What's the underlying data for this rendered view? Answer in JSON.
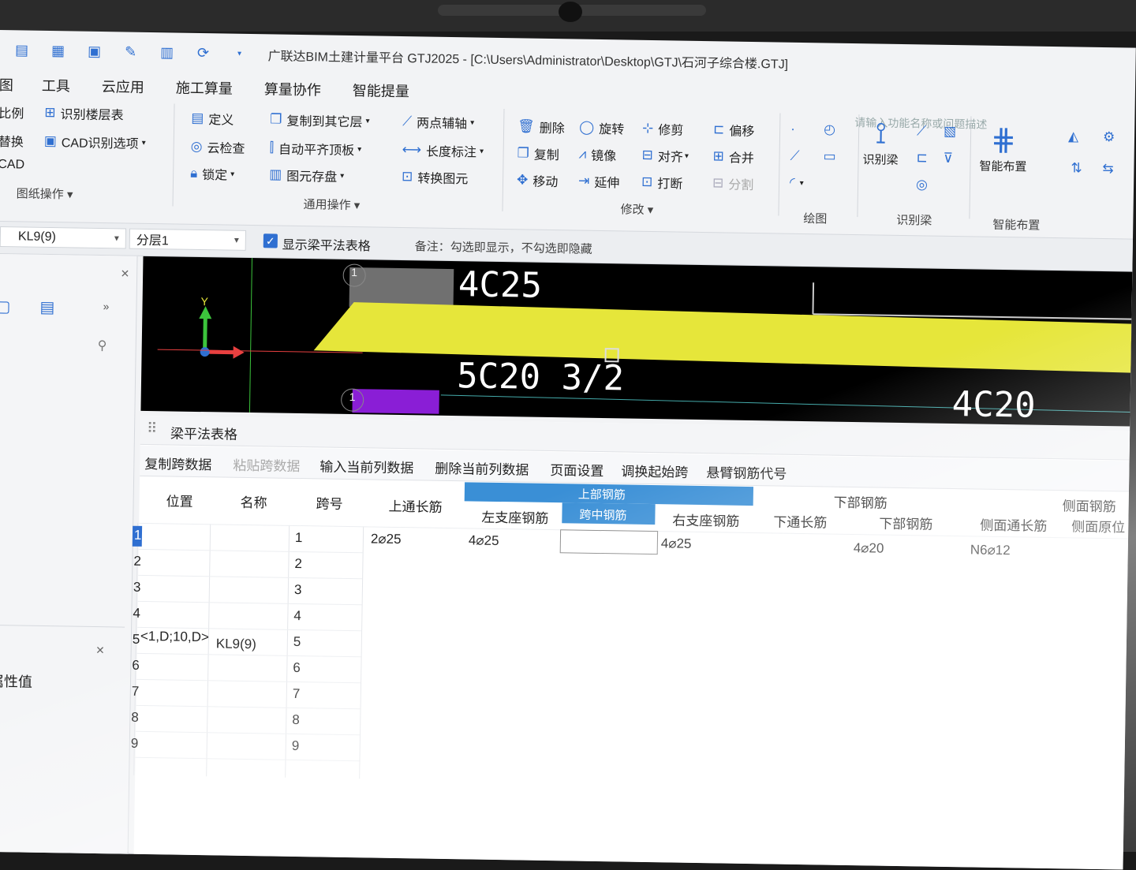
{
  "window": {
    "title": "广联达BIM土建计量平台 GTJ2025 - [C:\\Users\\Administrator\\Desktop\\GTJ\\石河子综合楼.GTJ]",
    "search_hint": "请输入功能名称或问题描述"
  },
  "menu": [
    "图",
    "工具",
    "云应用",
    "施工算量",
    "算量协作",
    "智能提量"
  ],
  "ribbon": {
    "left": [
      "比例",
      "识别楼层表",
      "替换",
      "CAD识别选项",
      "CAD"
    ],
    "left_group": "图纸操作",
    "common": [
      "定义",
      "复制到其它层",
      "两点辅轴",
      "云检查",
      "自动平齐顶板",
      "长度标注",
      "锁定",
      "图元存盘",
      "转换图元"
    ],
    "common_group": "通用操作",
    "modify": [
      "删除",
      "旋转",
      "修剪",
      "偏移",
      "复制",
      "镜像",
      "对齐",
      "合并",
      "移动",
      "延伸",
      "打断",
      "分割"
    ],
    "modify_group": "修改",
    "draw_group": "绘图",
    "identify_label": "识别梁",
    "identify_group": "识别梁",
    "smart_label": "智能布置",
    "smart_group": "智能布置"
  },
  "toolbar": {
    "element": "KL9(9)",
    "layer": "分层1",
    "show_table_label": "显示梁平法表格",
    "note": "备注：勾选即显示，不勾选即隐藏"
  },
  "canvas": {
    "texts": [
      "4C25",
      "5C20 3/2",
      "4C20"
    ],
    "axis_markers": [
      "1",
      "1"
    ],
    "y_label": "Y",
    "colors": {
      "background": "#000000",
      "beam": "#e6e63a",
      "purple": "#8a1ed6",
      "axis_green": "#3cc43c",
      "axis_red": "#e84040"
    }
  },
  "beam_table": {
    "title": "梁平法表格",
    "tools": [
      "复制跨数据",
      "粘贴跨数据",
      "输入当前列数据",
      "删除当前列数据",
      "页面设置",
      "调换起始跨",
      "悬臂钢筋代号"
    ],
    "headers": {
      "position": "位置",
      "name": "名称",
      "span": "跨号",
      "top_through": "上通长筋",
      "upper_rebar": "上部钢筋",
      "left_seat": "左支座钢筋",
      "mid": "跨中钢筋",
      "right_seat": "右支座钢筋",
      "bottom_group": "下部钢筋",
      "bottom_through": "下通长筋",
      "bottom_rebar": "下部钢筋",
      "side_group": "侧面钢筋",
      "side_through": "侧面通长筋",
      "side_original": "侧面原位"
    },
    "row_numbers": [
      "1",
      "2",
      "3",
      "4",
      "5",
      "6",
      "7",
      "8",
      "9"
    ],
    "position_value": "<1,D;10,D>",
    "name_value": "KL9(9)",
    "spans": [
      "1",
      "2",
      "3",
      "4",
      "5",
      "6",
      "7",
      "8",
      "9"
    ],
    "row1": {
      "top_through": "2⌀25",
      "left_seat": "4⌀25",
      "right_seat": "4⌀25",
      "bottom_rebar": "4⌀20",
      "side_through": "N6⌀12"
    }
  },
  "properties_panel": {
    "label": "属性值"
  }
}
